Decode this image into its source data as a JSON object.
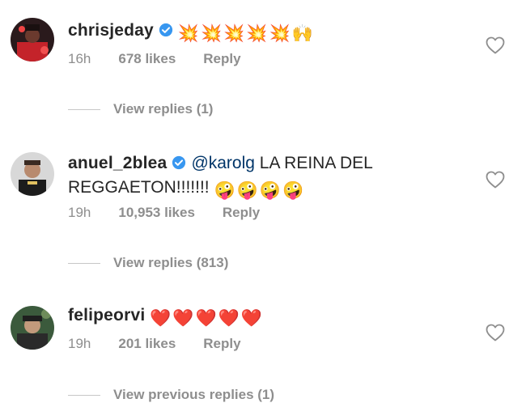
{
  "comments": [
    {
      "username": "chrisjeday",
      "verified": true,
      "mention": "",
      "text": "",
      "emojis": [
        "💥",
        "💥",
        "💥",
        "💥",
        "💥",
        "🙌"
      ],
      "time": "16h",
      "likes": "678 likes",
      "reply": "Reply",
      "view_replies": "View replies (1)"
    },
    {
      "username": "anuel_2blea",
      "verified": true,
      "mention": "@karolg",
      "text_line1": "LA REINA DEL",
      "text_line2": "REGGAETON!!!!!!!",
      "emojis": [
        "🤪",
        "🤪",
        "🤪",
        "🤪"
      ],
      "time": "19h",
      "likes": "10,953 likes",
      "reply": "Reply",
      "view_replies": "View replies (813)"
    },
    {
      "username": "felipeorvi",
      "verified": false,
      "emojis": [
        "❤️",
        "❤️",
        "❤️",
        "❤️",
        "❤️"
      ],
      "time": "19h",
      "likes": "201 likes",
      "reply": "Reply",
      "view_replies": "View previous replies (1)"
    }
  ],
  "colors": {
    "username": "#262626",
    "meta": "#8e8e8e",
    "mention": "#003569",
    "verified_badge": "#3897f0",
    "heart_outline": "#8e8e8e"
  },
  "icons": [
    "verified-badge-icon",
    "heart-outline-icon",
    "avatar"
  ]
}
